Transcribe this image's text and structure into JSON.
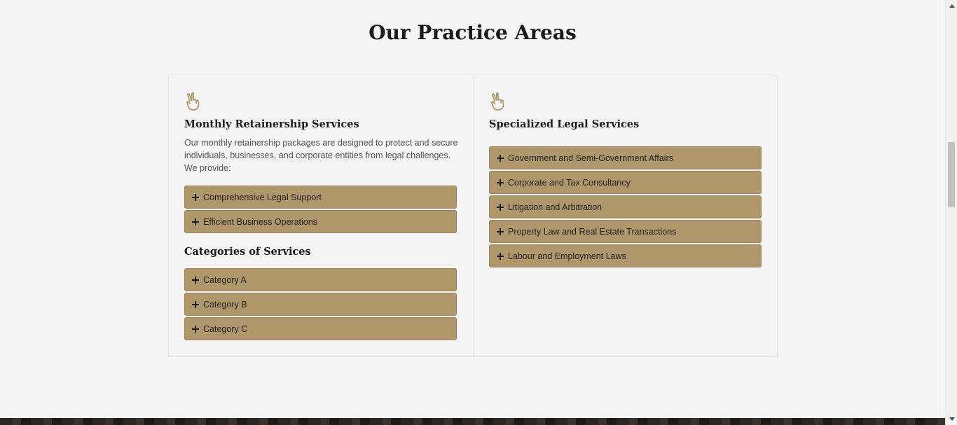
{
  "section": {
    "title": "Our Practice Areas"
  },
  "left": {
    "icon": "hand-peace-icon",
    "title": "Monthly Retainership Services",
    "description": "Our monthly retainership packages are designed to protect and secure individuals, businesses, and corporate entities from legal challenges. We provide:",
    "items": [
      {
        "label": "Comprehensive Legal Support"
      },
      {
        "label": "Efficient Business Operations"
      }
    ],
    "categories_title": "Categories of Services",
    "categories": [
      {
        "label": "Category A"
      },
      {
        "label": "Category B"
      },
      {
        "label": "Category C"
      }
    ]
  },
  "right": {
    "icon": "hand-peace-icon",
    "title": "Specialized Legal Services",
    "items": [
      {
        "label": "Government and Semi-Government Affairs"
      },
      {
        "label": "Corporate and Tax Consultancy"
      },
      {
        "label": "Litigation and Arbitration"
      },
      {
        "label": "Property Law and Real Estate Transactions"
      },
      {
        "label": "Labour and Employment Laws"
      }
    ]
  },
  "colors": {
    "accent": "#b0966b",
    "icon": "#b0966b",
    "background": "#f4f4f4",
    "heading": "#1b1b1b"
  }
}
